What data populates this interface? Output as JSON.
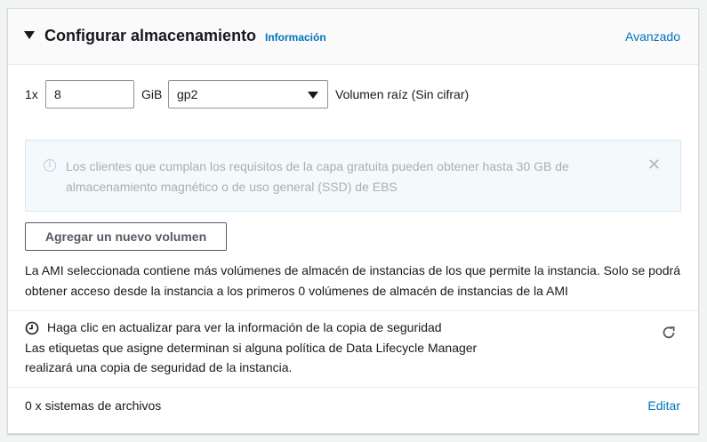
{
  "header": {
    "title": "Configurar almacenamiento",
    "info_link": "Información",
    "advanced_link": "Avanzado"
  },
  "volume": {
    "count_label": "1x",
    "size_value": "8",
    "unit": "GiB",
    "type_value": "gp2",
    "root_label": "Volumen raíz  (Sin cifrar)"
  },
  "alert": {
    "icon": "info-icon",
    "text": "Los clientes que cumplan los requisitos de la capa gratuita pueden obtener hasta 30 GB de almacenamiento magnético o de uso general (SSD) de EBS"
  },
  "add_volume_button": "Agregar un nuevo volumen",
  "ami_note": "La AMI seleccionada contiene más volúmenes de almacén de instancias de los que permite la instancia. Solo se podrá obtener acceso desde la instancia a los primeros 0 volúmenes de almacén de instancias de la AMI",
  "backup": {
    "icon": "clock-icon",
    "title": "Haga clic en actualizar para ver la información de la copia de seguridad",
    "description": "Las etiquetas que asigne determinan si alguna política de Data Lifecycle Manager realizará una copia de seguridad de la instancia.",
    "refresh_icon": "refresh-icon"
  },
  "filesystems": {
    "label": "0 x sistemas de archivos",
    "edit_link": "Editar"
  },
  "colors": {
    "link": "#0073bb",
    "text": "#16191f",
    "alert_bg": "#f4f9fc",
    "alert_border": "#d6e8f4"
  }
}
